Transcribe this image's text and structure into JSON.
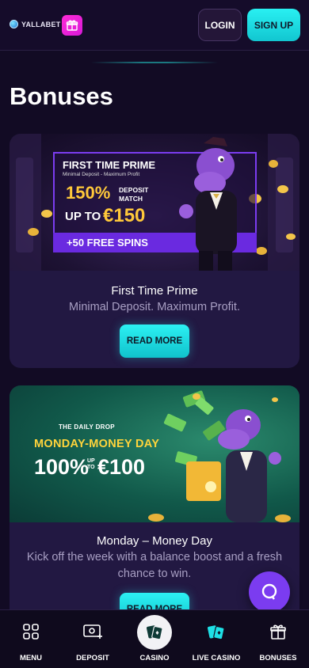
{
  "header": {
    "logo_text": "YALLABET",
    "login_label": "LOGIN",
    "signup_label": "SIGN UP"
  },
  "page": {
    "title": "Bonuses"
  },
  "bonuses": [
    {
      "banner": {
        "headline": "FIRST TIME PRIME",
        "subline": "Minimal Deposit - Maximum Profit",
        "percent": "150%",
        "deposit_match": "DEPOSIT MATCH",
        "up_to": "UP TO",
        "amount": "€150",
        "spins": "+50 FREE SPINS"
      },
      "title": "First Time Prime",
      "description": "Minimal Deposit. Maximum Profit.",
      "button": "READ MORE"
    },
    {
      "banner": {
        "kicker": "THE DAILY DROP",
        "headline": "MONDAY-MONEY DAY",
        "percent": "100%",
        "up_to": "UP TO",
        "amount": "€100"
      },
      "title": "Monday – Money Day",
      "description": "Kick off the week with a balance boost and a fresh chance to win.",
      "button": "READ MORE"
    }
  ],
  "nav": [
    {
      "label": "MENU",
      "icon": "grid-icon"
    },
    {
      "label": "DEPOSIT",
      "icon": "deposit-icon"
    },
    {
      "label": "CASINO",
      "icon": "cards-icon"
    },
    {
      "label": "LIVE CASINO",
      "icon": "live-cards-icon"
    },
    {
      "label": "BONUSES",
      "icon": "gift-icon"
    }
  ],
  "colors": {
    "accent_cyan": "#1ee0e6",
    "brand_purple": "#7b3cf0",
    "background": "#120b24",
    "card": "#221842",
    "gold": "#ffc83a"
  }
}
